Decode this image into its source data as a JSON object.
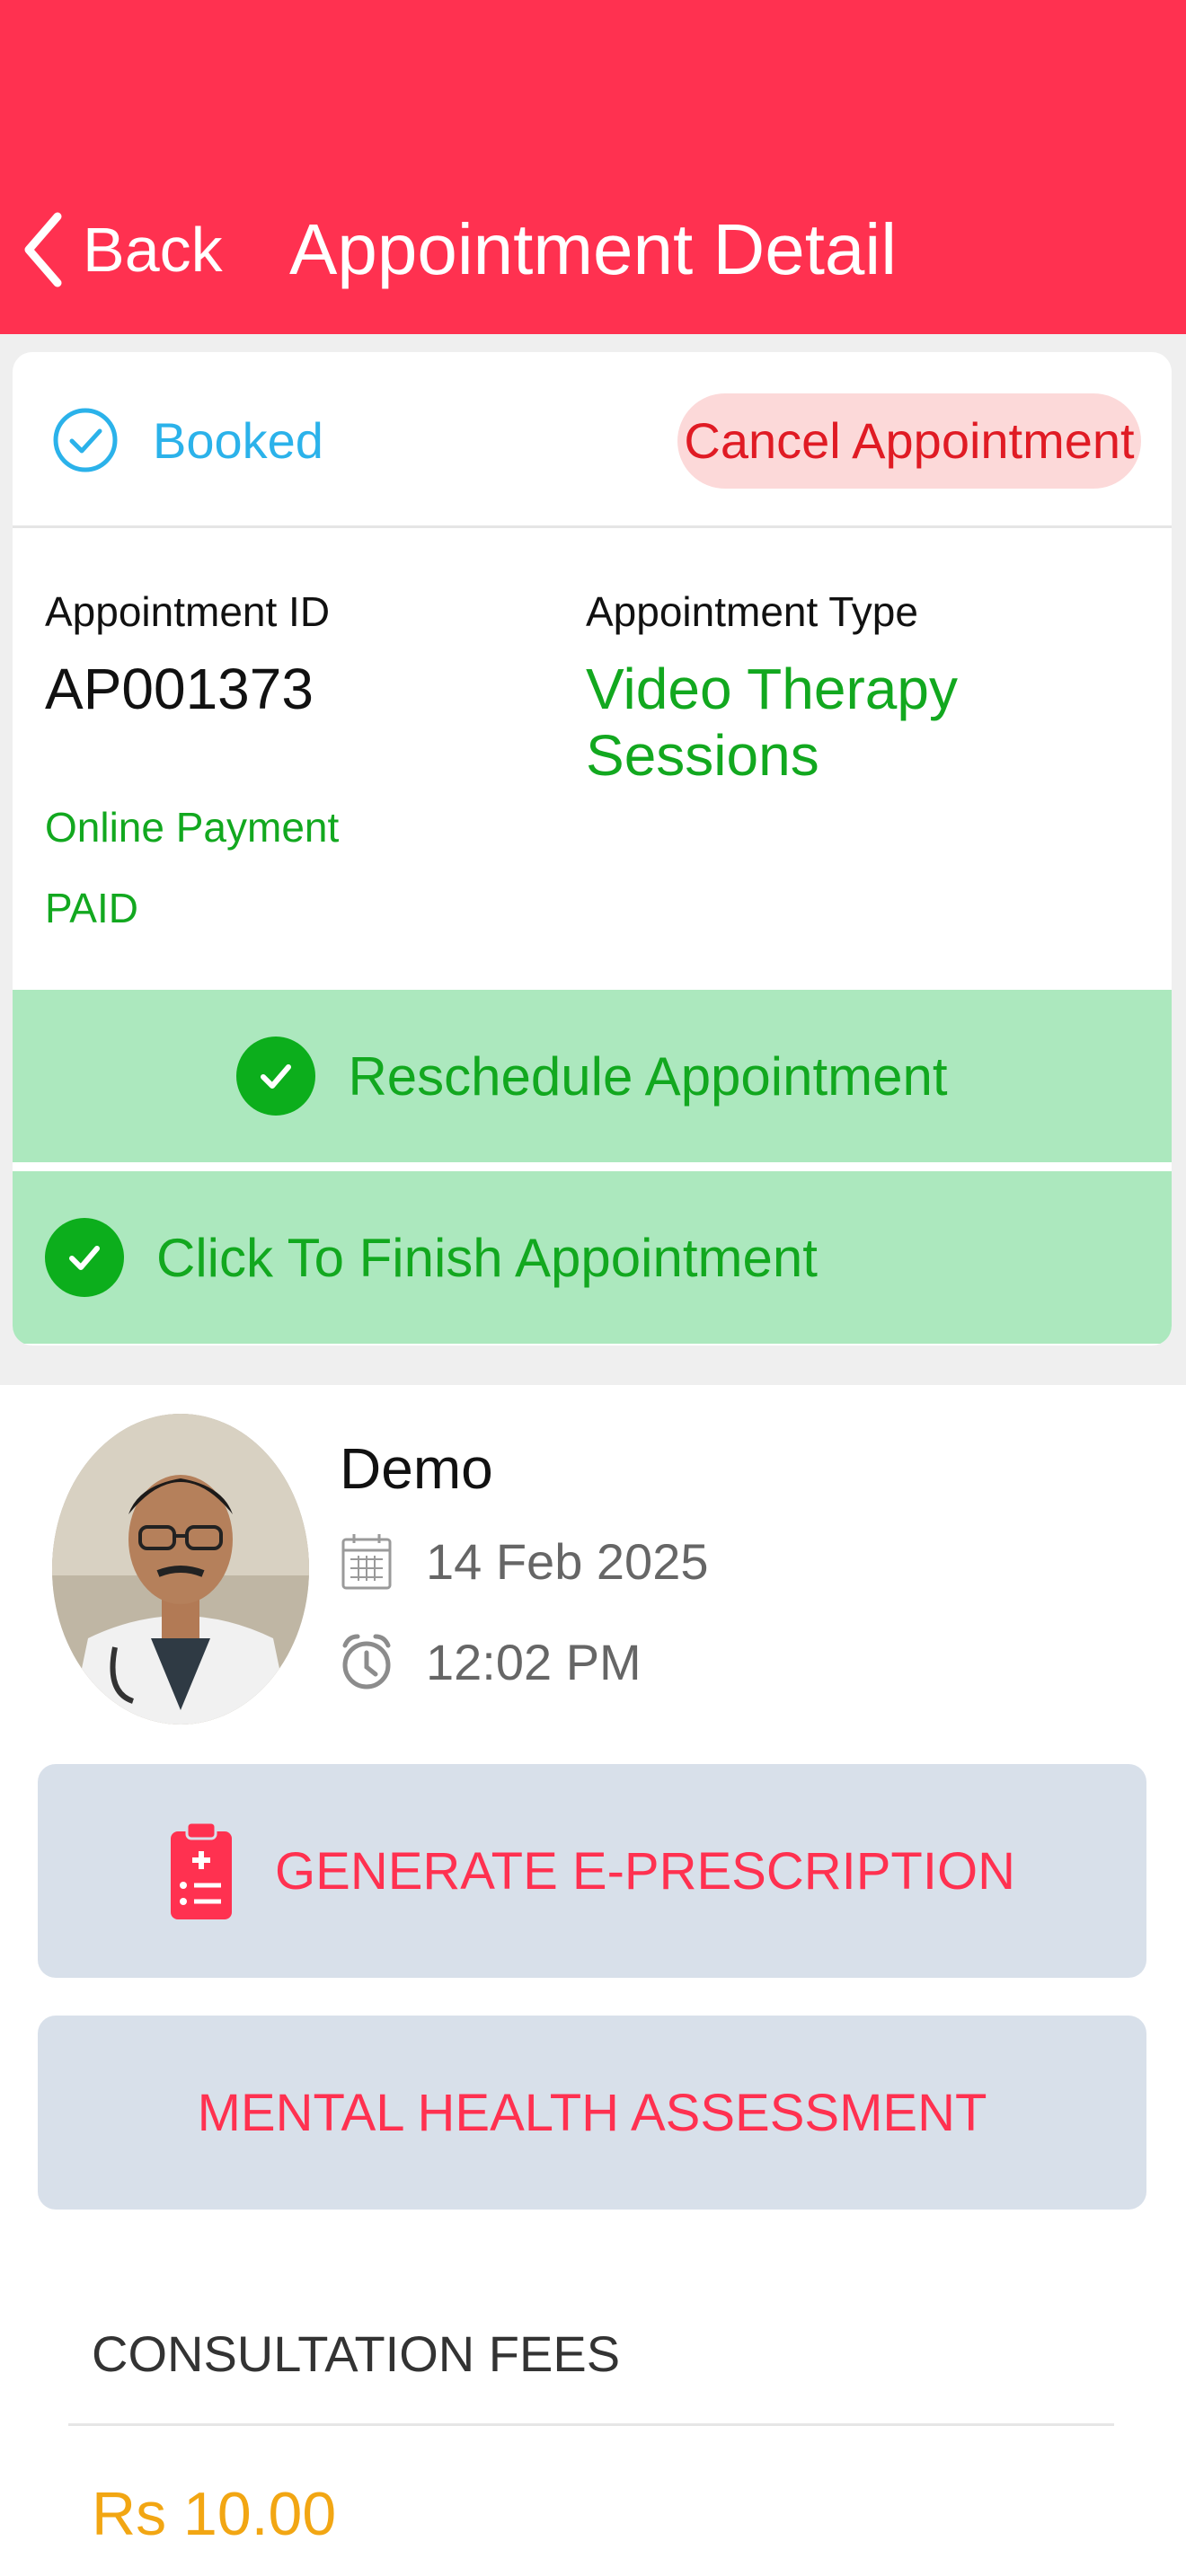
{
  "header": {
    "back_label": "Back",
    "title": "Appointment Detail"
  },
  "status": {
    "label": "Booked",
    "cancel_label": "Cancel Appointment"
  },
  "appointment": {
    "id_label": "Appointment ID",
    "id_value": "AP001373",
    "type_label": "Appointment Type",
    "type_value": "Video Therapy Sessions",
    "payment_method": "Online Payment",
    "payment_status": "PAID"
  },
  "actions": {
    "reschedule_label": "Reschedule Appointment",
    "finish_label": "Click To Finish Appointment"
  },
  "doctor": {
    "name": "Demo",
    "date": "14 Feb 2025",
    "time": "12:02 PM"
  },
  "buttons": {
    "prescription_label": "GENERATE E-PRESCRIPTION",
    "assessment_label": "MENTAL HEALTH ASSESSMENT"
  },
  "fees": {
    "label": "CONSULTATION FEES",
    "value": "Rs 10.00"
  },
  "icons": {
    "back": "chevron-left-icon",
    "booked": "check-circle-icon",
    "reschedule": "check-circle-filled-icon",
    "finish": "check-circle-filled-icon",
    "date": "calendar-icon",
    "time": "alarm-clock-icon",
    "prescription": "clipboard-prescription-icon"
  },
  "colors": {
    "brand": "#ff3150",
    "booked": "#2bb2ea",
    "success": "#12a81f",
    "success_bg": "#ace8be",
    "cancel_bg": "#fcd9d9",
    "fees": "#f2a613",
    "button_bg": "#d8e0ea"
  }
}
